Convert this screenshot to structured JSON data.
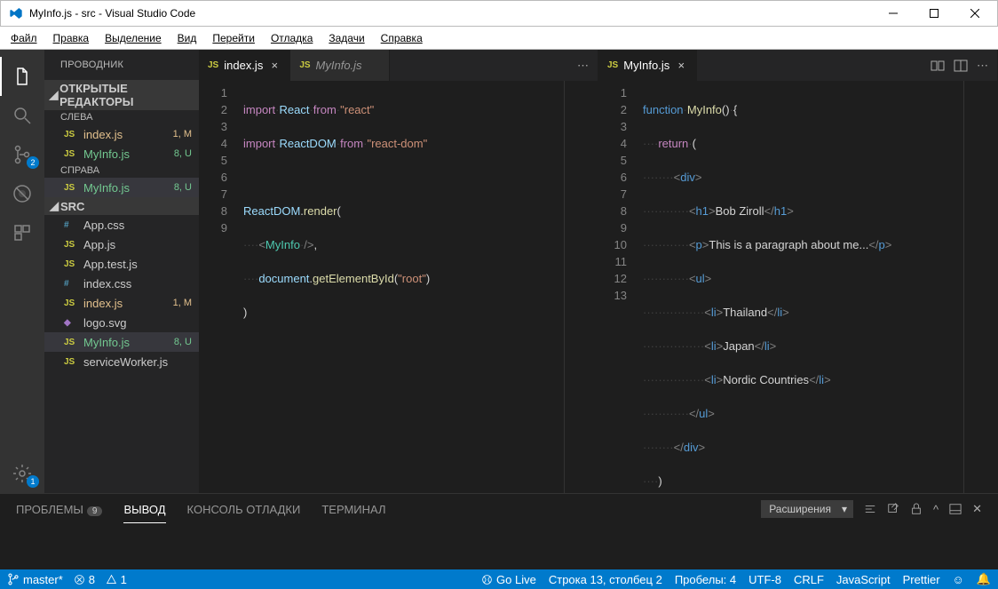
{
  "window": {
    "title": "MyInfo.js - src - Visual Studio Code"
  },
  "menu": [
    "Файл",
    "Правка",
    "Выделение",
    "Вид",
    "Перейти",
    "Отладка",
    "Задачи",
    "Справка"
  ],
  "activity": {
    "scm_badge": "2",
    "settings_badge": "1"
  },
  "sidebar": {
    "title": "ПРОВОДНИК",
    "open_editors": "ОТКРЫТЫЕ РЕДАКТОРЫ",
    "left": "СЛЕВА",
    "right": "СПРАВА",
    "src": "SRC",
    "open_left": [
      {
        "icon": "JS",
        "name": "index.js",
        "status": "1, M",
        "cls": "mod"
      },
      {
        "icon": "JS",
        "name": "MyInfo.js",
        "status": "8, U",
        "cls": "untracked"
      }
    ],
    "open_right": [
      {
        "icon": "JS",
        "name": "MyInfo.js",
        "status": "8, U",
        "cls": "untracked active"
      }
    ],
    "files": [
      {
        "icon": "#",
        "name": "App.css",
        "cls": "",
        "iconcls": "css"
      },
      {
        "icon": "JS",
        "name": "App.js",
        "cls": "",
        "iconcls": "js"
      },
      {
        "icon": "JS",
        "name": "App.test.js",
        "cls": "",
        "iconcls": "js"
      },
      {
        "icon": "#",
        "name": "index.css",
        "cls": "",
        "iconcls": "css"
      },
      {
        "icon": "JS",
        "name": "index.js",
        "status": "1, M",
        "cls": "mod",
        "iconcls": "js"
      },
      {
        "icon": "◆",
        "name": "logo.svg",
        "cls": "",
        "iconcls": "svg"
      },
      {
        "icon": "JS",
        "name": "MyInfo.js",
        "status": "8, U",
        "cls": "untracked active",
        "iconcls": "js"
      },
      {
        "icon": "JS",
        "name": "serviceWorker.js",
        "cls": "",
        "iconcls": "js"
      }
    ]
  },
  "editor_left": {
    "tabs": [
      {
        "icon": "JS",
        "name": "index.js",
        "active": true
      },
      {
        "icon": "JS",
        "name": "MyInfo.js",
        "active": false
      }
    ]
  },
  "editor_right": {
    "tabs": [
      {
        "icon": "JS",
        "name": "MyInfo.js",
        "active": true
      }
    ]
  },
  "panel": {
    "problems": "ПРОБЛЕМЫ",
    "problems_badge": "9",
    "output": "ВЫВОД",
    "debug": "КОНСОЛЬ ОТЛАДКИ",
    "terminal": "ТЕРМИНАЛ",
    "dropdown": "Расширения"
  },
  "status": {
    "branch": "master*",
    "errors": "8",
    "warnings": "1",
    "golive": "Go Live",
    "pos": "Строка 13, столбец 2",
    "spaces": "Пробелы: 4",
    "encoding": "UTF-8",
    "eol": "CRLF",
    "lang": "JavaScript",
    "prettier": "Prettier"
  }
}
